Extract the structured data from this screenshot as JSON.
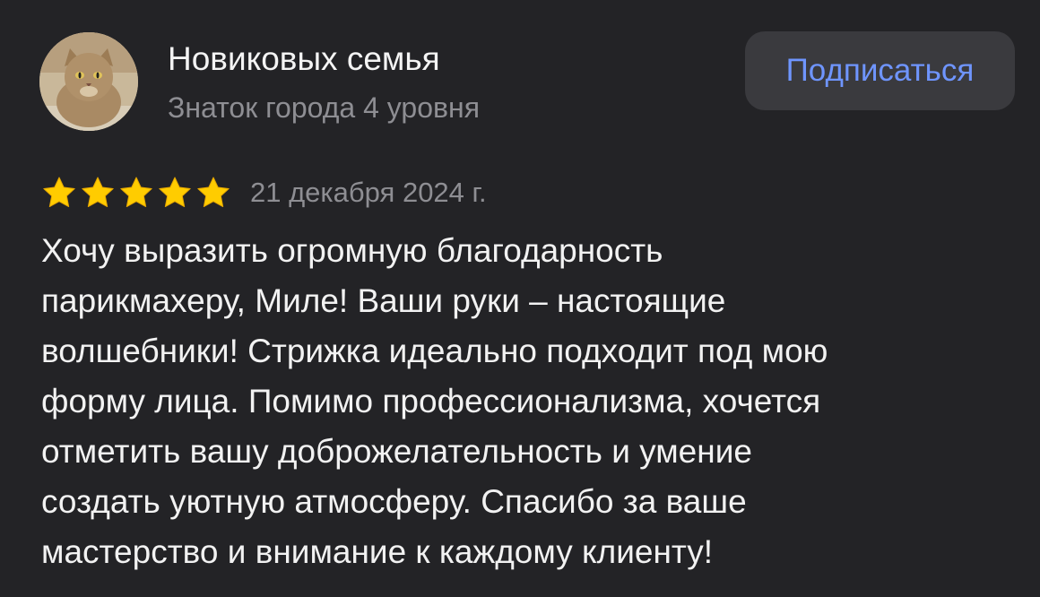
{
  "author": {
    "name": "Новиковых семья",
    "status": "Знаток города 4 уровня"
  },
  "subscribe_label": "Подписаться",
  "review": {
    "rating": 5,
    "max_rating": 5,
    "date": "21 декабря 2024 г.",
    "text_lines": [
      "Хочу выразить огромную благодарность",
      "парикмахеру, Миле! Ваши руки – настоящие",
      "волшебники! Стрижка идеально подходит под мою",
      "форму лица. Помимо профессионализма, хочется",
      "отметить вашу доброжелательность и умение",
      "создать уютную атмосферу. Спасибо за ваше",
      "мастерство и внимание к каждому клиенту!"
    ]
  },
  "colors": {
    "background": "#232326",
    "button_background": "#3a3a3e",
    "accent_blue": "#6f95ff",
    "star_yellow": "#ffcc00",
    "secondary_text": "#8e8e93"
  }
}
